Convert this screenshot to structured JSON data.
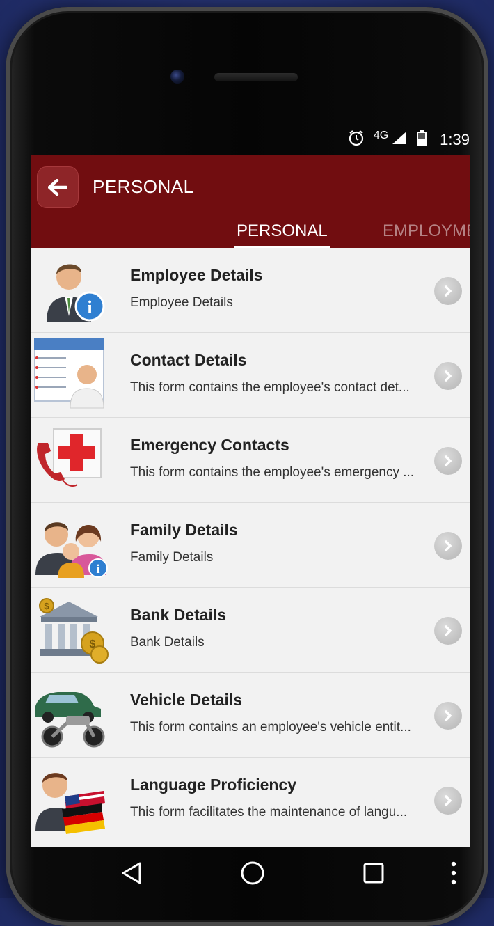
{
  "status": {
    "network": "4G",
    "time": "1:39"
  },
  "header": {
    "title": "PERSONAL"
  },
  "tabs": [
    {
      "label": "PERSONAL",
      "active": true
    },
    {
      "label": "EMPLOYME",
      "active": false
    }
  ],
  "items": [
    {
      "title": "Employee Details",
      "desc": "Employee Details",
      "icon": "employee-info-icon"
    },
    {
      "title": "Contact Details",
      "desc": "This form contains the employee's contact det...",
      "icon": "contact-card-icon"
    },
    {
      "title": "Emergency Contacts",
      "desc": "This form contains the employee's emergency ...",
      "icon": "emergency-phone-icon"
    },
    {
      "title": "Family Details",
      "desc": "Family Details",
      "icon": "family-icon"
    },
    {
      "title": "Bank Details",
      "desc": "Bank Details",
      "icon": "bank-icon"
    },
    {
      "title": "Vehicle Details",
      "desc": "This form contains an employee's vehicle entit...",
      "icon": "vehicle-icon"
    },
    {
      "title": "Language Proficiency",
      "desc": "This form facilitates the maintenance of langu...",
      "icon": "language-flags-icon"
    }
  ],
  "colors": {
    "appbar": "#710d10",
    "list_bg": "#f2f2f2"
  }
}
